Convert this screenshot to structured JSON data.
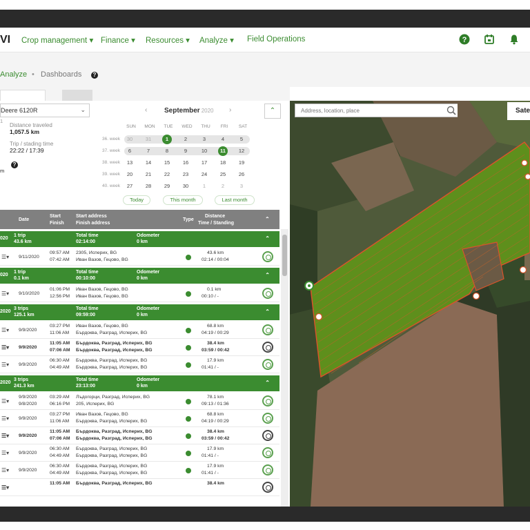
{
  "navbar": {
    "logo": "VI",
    "items": [
      "Crop management",
      "Finance",
      "Resources",
      "Analyze",
      "Field Operations"
    ]
  },
  "breadcrumb": {
    "active": "Analyze",
    "separator": "•",
    "current": "Dashboards"
  },
  "vehicle": {
    "selected": "Deere 6120R",
    "sub": "1"
  },
  "info": {
    "distance_label": "Distance traveled",
    "distance_value": "1,057.5 km",
    "time_label": "Trip / stading time",
    "time_value": "22:22 / 17:39",
    "extra": "m"
  },
  "calendar": {
    "month": "September",
    "year": "2020",
    "prev": "‹",
    "next": "›",
    "weekdays": [
      "SUN",
      "MON",
      "TUE",
      "WED",
      "THU",
      "FRI",
      "SAT"
    ],
    "weeks": [
      {
        "label": "36. week",
        "days": [
          "30",
          "31",
          "1",
          "2",
          "3",
          "4",
          "5"
        ]
      },
      {
        "label": "37. week",
        "days": [
          "6",
          "7",
          "8",
          "9",
          "10",
          "11",
          "12"
        ]
      },
      {
        "label": "38. week",
        "days": [
          "13",
          "14",
          "15",
          "16",
          "17",
          "18",
          "19"
        ]
      },
      {
        "label": "39. week",
        "days": [
          "20",
          "21",
          "22",
          "23",
          "24",
          "25",
          "26"
        ]
      },
      {
        "label": "40. week",
        "days": [
          "27",
          "28",
          "29",
          "30",
          "1",
          "2",
          "3"
        ]
      }
    ],
    "buttons": [
      "Today",
      "This month",
      "Last month"
    ]
  },
  "table": {
    "headers": {
      "date": "Date",
      "start": "Start",
      "finish": "Finish",
      "start_address": "Start address",
      "finish_address": "Finish address",
      "type": "Type",
      "distance": "Distance",
      "time_standing": "Time / Standing"
    },
    "groups": [
      {
        "date": "020",
        "trips": "1 trip",
        "km": "43.6 km",
        "total_label": "Total time",
        "total": "02:14:00",
        "odo_label": "Odometer",
        "odo": "0 km",
        "rows": [
          {
            "date": "9/11/2020",
            "start": "09:57 AM",
            "finish": "07:42 AM",
            "addr1": "2305, Исперих, BG",
            "addr2": "Иван Вазов, Гецово, BG",
            "dist": "43.6 km",
            "time": "02:14 / 00:04",
            "bold": false
          }
        ]
      },
      {
        "date": "020",
        "trips": "1 trip",
        "km": "0.1 km",
        "total_label": "Total time",
        "total": "00:10:00",
        "odo_label": "Odometer",
        "odo": "0 km",
        "rows": [
          {
            "date": "9/10/2020",
            "start": "01:06 PM",
            "finish": "12:56 PM",
            "addr1": "Иван Вазов, Гецово, BG",
            "addr2": "Иван Вазов, Гецово, BG",
            "dist": "0.1 km",
            "time": "00:10 / -",
            "bold": false
          }
        ]
      },
      {
        "date": "2020",
        "trips": "3 trips",
        "km": "125.1 km",
        "total_label": "Total time",
        "total": "09:59:00",
        "odo_label": "Odometer",
        "odo": "0 km",
        "rows": [
          {
            "date": "9/9/2020",
            "start": "03:27 PM",
            "finish": "11:06 AM",
            "addr1": "Иван Вазов, Гецово, BG",
            "addr2": "Бърдоква, Разград, Исперих, BG",
            "dist": "68.8 km",
            "time": "04:19 / 00:29",
            "bold": false
          },
          {
            "date": "9/9/2020",
            "start": "11:05 AM",
            "finish": "07:06 AM",
            "addr1": "Бърдоква, Разград, Исперих, BG",
            "addr2": "Бърдоква, Разград, Исперих, BG",
            "dist": "38.4 km",
            "time": "03:59 / 00:42",
            "bold": true
          },
          {
            "date": "9/9/2020",
            "start": "06:30 AM",
            "finish": "04:49 AM",
            "addr1": "Бърдоква, Разград, Исперих, BG",
            "addr2": "Бърдоква, Разград, Исперих, BG",
            "dist": "17.9 km",
            "time": "01:41 / -",
            "bold": false
          }
        ]
      },
      {
        "date": "2020",
        "trips": "3 trips",
        "km": "241.3 km",
        "total_label": "Total time",
        "total": "23:13:00",
        "odo_label": "Odometer",
        "odo": "0 km",
        "rows": [
          {
            "date": "9/9/2020",
            "date2": "9/8/2020",
            "start": "03:29 AM",
            "finish": "06:16 PM",
            "addr1": "Лъдогорци, Разград, Исперих, BG",
            "addr2": "205, Исперих, BG",
            "dist": "78.1 km",
            "time": "09:13 / 01:36",
            "bold": false
          },
          {
            "date": "9/9/2020",
            "start": "03:27 PM",
            "finish": "11:06 AM",
            "addr1": "Иван Вазов, Гецово, BG",
            "addr2": "Бърдоква, Разград, Исперих, BG",
            "dist": "68.8 km",
            "time": "04:19 / 00:29",
            "bold": false
          },
          {
            "date": "9/9/2020",
            "start": "11:05 AM",
            "finish": "07:06 AM",
            "addr1": "Бърдоква, Разград, Исперих, BG",
            "addr2": "Бърдоква, Разград, Исперих, BG",
            "dist": "38.4 km",
            "time": "03:59 / 00:42",
            "bold": true
          },
          {
            "date": "9/9/2020",
            "start": "06:30 AM",
            "finish": "04:49 AM",
            "addr1": "Бърдоква, Разград, Исперих, BG",
            "addr2": "Бърдоква, Разград, Исперих, BG",
            "dist": "17.9 km",
            "time": "01:41 / -",
            "bold": false
          },
          {
            "date": "9/9/2020",
            "start": "06:30 AM",
            "finish": "04:49 AM",
            "addr1": "Бърдоква, Разград, Исперих, BG",
            "addr2": "Бърдоква, Разград, Исперих, BG",
            "dist": "17.9 km",
            "time": "01:41 / -",
            "bold": false
          },
          {
            "date": "",
            "start": "11:05 AM",
            "finish": "",
            "addr1": "Бърдоква, Разград, Исперих, BG",
            "addr2": "",
            "dist": "38.4 km",
            "time": "",
            "bold": true
          }
        ]
      }
    ]
  },
  "map": {
    "search_placeholder": "Address, location, place",
    "layer_button": "Sate",
    "colors": {
      "field": "#5e8f1c",
      "track": "#d9542a",
      "accent": "#3b8c30"
    }
  }
}
